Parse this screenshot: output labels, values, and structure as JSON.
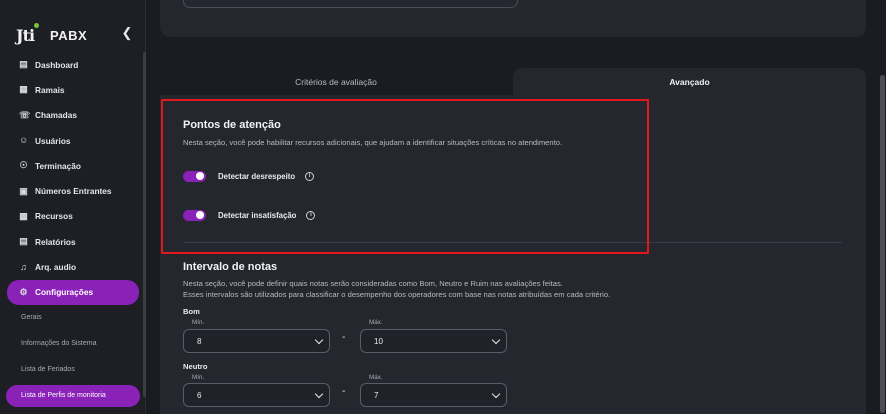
{
  "brand": {
    "logo": "Jti",
    "product": "PABX"
  },
  "sidebar": {
    "collapse_icon": "chevron-left-icon",
    "items": [
      {
        "label": "Dashboard",
        "icon": "chart-icon"
      },
      {
        "label": "Ramais",
        "icon": "extension-icon"
      },
      {
        "label": "Chamadas",
        "icon": "phone-icon"
      },
      {
        "label": "Usuários",
        "icon": "user-icon"
      },
      {
        "label": "Terminação",
        "icon": "globe-icon"
      },
      {
        "label": "Números Entrantes",
        "icon": "number-icon"
      },
      {
        "label": "Recursos",
        "icon": "resources-icon"
      },
      {
        "label": "Relatórios",
        "icon": "report-icon"
      },
      {
        "label": "Arq. audio",
        "icon": "audio-file-icon"
      },
      {
        "label": "Configurações",
        "icon": "gear-icon",
        "active": true
      }
    ],
    "sub_items": [
      {
        "label": "Gerais"
      },
      {
        "label": "Informações do Sistema"
      },
      {
        "label": "Lista de Feriados"
      },
      {
        "label": "Lista de Perfis de monitoria",
        "active": true
      }
    ]
  },
  "tabs": [
    {
      "label": "Critérios de avaliação"
    },
    {
      "label": "Avançado",
      "active": true
    }
  ],
  "attention": {
    "title": "Pontos de atenção",
    "description": "Nesta seção, você pode habilitar recursos adicionais, que ajudam a identificar situações críticas no atendimento.",
    "toggles": [
      {
        "label": "Detectar desrespeito",
        "enabled": true
      },
      {
        "label": "Detectar insatisfação",
        "enabled": true
      }
    ]
  },
  "intervals": {
    "title": "Intervalo de notas",
    "description_1": "Nesta seção, você pode definir quais notas serão consideradas como Bom, Neutro e Ruim nas avaliações feitas.",
    "description_2": "Esses intervalos são utilizados para classificar o desempenho dos operadores com base nas notas atribuídas em cada critério.",
    "min_label": "Mín.",
    "max_label": "Máx.",
    "separator": "-",
    "groups": [
      {
        "label": "Bom",
        "min": "8",
        "max": "10"
      },
      {
        "label": "Neutro",
        "min": "6",
        "max": "7"
      }
    ]
  },
  "colors": {
    "accent": "#8a22b8",
    "highlight": "#e3171e",
    "panel": "#24272e",
    "background": "#1a1c22"
  }
}
